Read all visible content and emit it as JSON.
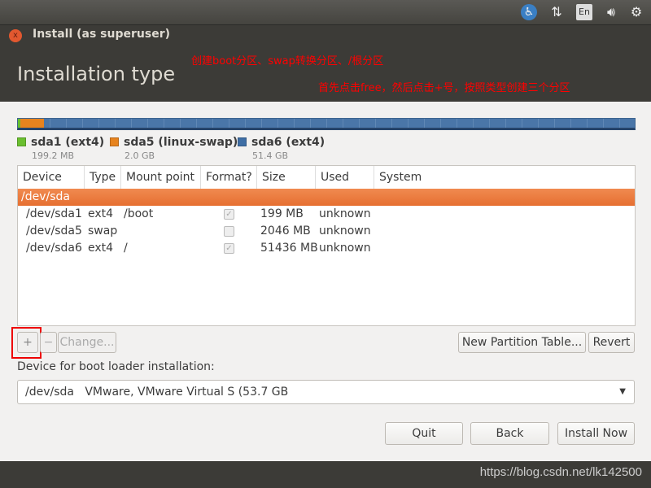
{
  "panel": {
    "indicators": [
      "accessibility-icon",
      "network-icon",
      "keyboard-layout",
      "volume-icon",
      "settings-icon"
    ],
    "keyboard_label": "En"
  },
  "window": {
    "title": "Install (as superuser)",
    "page_title": "Installation type"
  },
  "annotations": [
    "创建boot分区、swap转换分区、/根分区",
    "首先点击free，然后点击+号，按照类型创建三个分区"
  ],
  "partition_bar": {
    "segments": [
      {
        "name": "sda1 (ext4)",
        "size": "199.2 MB",
        "color": "#6abf2f",
        "fraction": 0.004
      },
      {
        "name": "sda5 (linux-swap)",
        "size": "2.0 GB",
        "color": "#e7831e",
        "fraction": 0.038
      },
      {
        "name": "sda6 (ext4)",
        "size": "51.4 GB",
        "color": "#3f6ea5",
        "fraction": 0.958
      }
    ]
  },
  "table": {
    "headers": [
      "Device",
      "Type",
      "Mount point",
      "Format?",
      "Size",
      "Used",
      "System"
    ],
    "disk": "/dev/sda",
    "rows": [
      {
        "device": "/dev/sda1",
        "type": "ext4",
        "mount": "/boot",
        "format": true,
        "size": "199 MB",
        "used": "unknown",
        "system": ""
      },
      {
        "device": "/dev/sda5",
        "type": "swap",
        "mount": "",
        "format": false,
        "size": "2046 MB",
        "used": "unknown",
        "system": ""
      },
      {
        "device": "/dev/sda6",
        "type": "ext4",
        "mount": "/",
        "format": true,
        "size": "51436 MB",
        "used": "unknown",
        "system": ""
      }
    ]
  },
  "buttons": {
    "add": "+",
    "remove": "−",
    "change": "Change...",
    "new_table": "New Partition Table...",
    "revert": "Revert",
    "quit": "Quit",
    "back": "Back",
    "install": "Install Now"
  },
  "bootloader": {
    "label": "Device for boot loader installation:",
    "device": "/dev/sda",
    "description": "VMware, VMware Virtual S (53.7 GB"
  },
  "watermark": "https://blog.csdn.net/lk142500"
}
